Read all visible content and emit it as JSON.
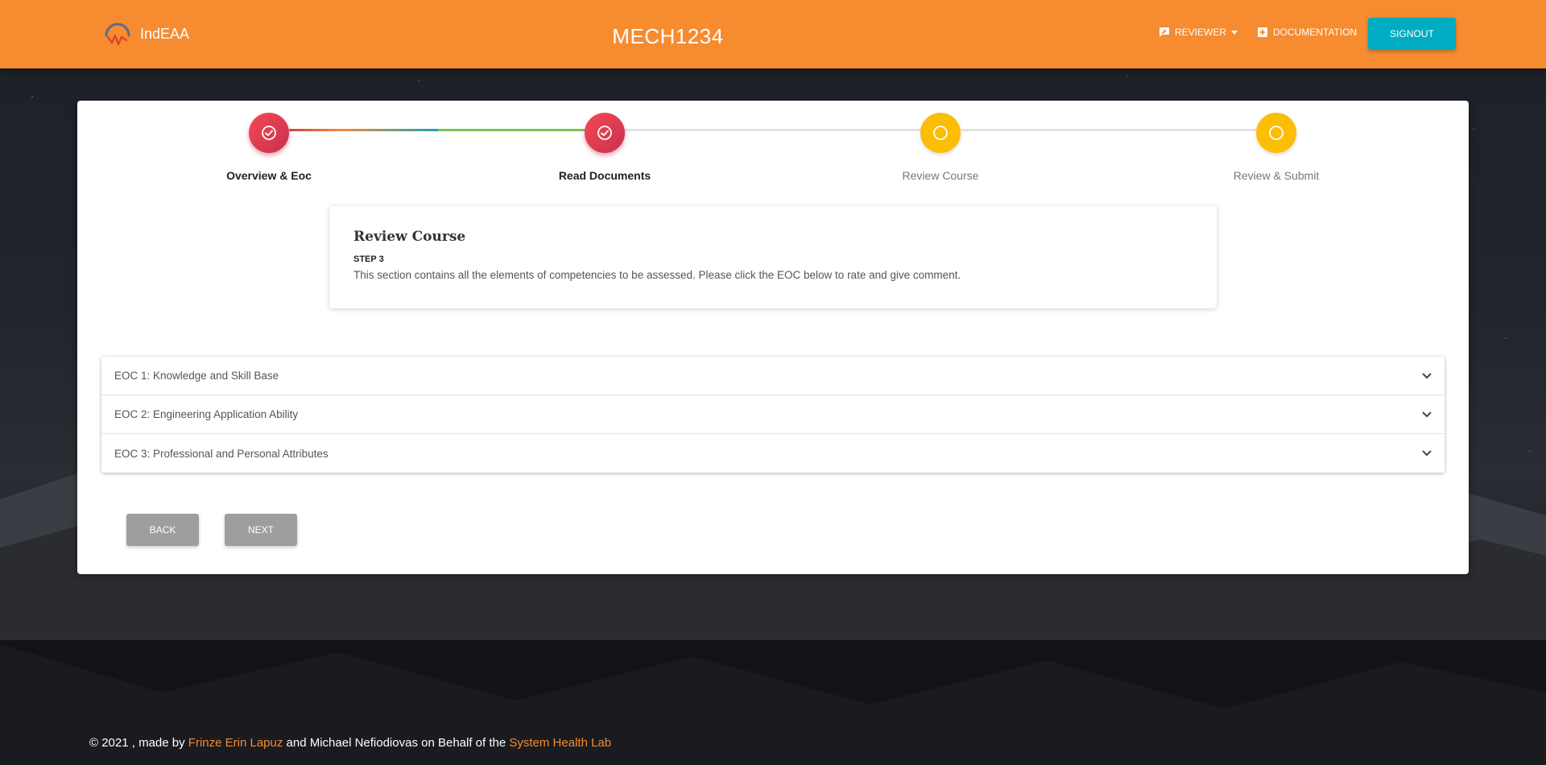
{
  "header": {
    "brand": "IndEAA",
    "course_code": "MECH1234",
    "nav": {
      "reviewer": "REVIEWER",
      "documentation": "DOCUMENTATION"
    },
    "signout": "SIGNOUT"
  },
  "stepper": {
    "steps": [
      {
        "label": "Overview & Eoc",
        "status": "completed"
      },
      {
        "label": "Read Documents",
        "status": "completed"
      },
      {
        "label": "Review Course",
        "status": "pending"
      },
      {
        "label": "Review & Submit",
        "status": "pending"
      }
    ]
  },
  "section": {
    "title": "Review Course",
    "step": "STEP 3",
    "description": "This section contains all the elements of competencies to be assessed. Please click the EOC below to rate and give comment."
  },
  "eocs": [
    {
      "label": "EOC 1: Knowledge and Skill Base"
    },
    {
      "label": "EOC 2: Engineering Application Ability"
    },
    {
      "label": "EOC 3: Professional and Personal Attributes"
    }
  ],
  "actions": {
    "back": "BACK",
    "next": "NEXT"
  },
  "footer": {
    "prefix": "© 2021 , made by ",
    "author1": "Frinze Erin Lapuz",
    "middle": " and Michael Nefiodiovas on Behalf of the ",
    "lab": "System Health Lab"
  },
  "colors": {
    "header": "#f68b30",
    "signout": "#00acc1",
    "step_done": "#e8404f",
    "step_pending": "#fcbd05",
    "button_disabled": "#9e9e9e"
  }
}
